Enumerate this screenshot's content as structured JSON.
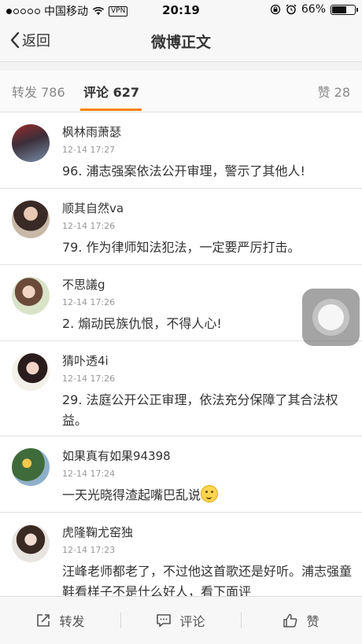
{
  "status_bar": {
    "carrier": "中国移动",
    "vpn": "VPN",
    "time": "20:19",
    "battery": "66%",
    "battery_level": 0.66
  },
  "nav": {
    "back_label": "返回",
    "title": "微博正文"
  },
  "tabs": {
    "repost": "转发 786",
    "comment": "评论 627",
    "like": "赞 28"
  },
  "comments": [
    {
      "name": "枫林雨萧瑟",
      "time": "12-14 17:27",
      "text": "96. 浦志强案依法公开审理，警示了其他人!"
    },
    {
      "name": "顺其自然va",
      "time": "12-14 17:26",
      "text": "79. 作为律师知法犯法，一定要严厉打击。"
    },
    {
      "name": "不思議g",
      "time": "12-14 17:26",
      "text": "2. 煽动民族仇恨，不得人心!"
    },
    {
      "name": "猜卟透4i",
      "time": "12-14 17:26",
      "text": "29. 法庭公开公正审理，依法充分保障了其合法权益。"
    },
    {
      "name": "如果真有如果94398",
      "time": "12-14 17:24",
      "text": "一天光晓得渣起嘴巴乱说"
    },
    {
      "name": "虎隆鞠尤窑独",
      "time": "12-14 17:23",
      "text": "汪峰老师都老了，不过他这首歌还是好听。浦志强童鞋看样子不是什么好人，看下面评"
    }
  ],
  "toolbar": {
    "repost": "转发",
    "comment": "评论",
    "like": "赞"
  },
  "colors": {
    "accent": "#ff8200"
  },
  "icons": [
    "back-chevron-icon",
    "wifi-icon",
    "lock-rotation-icon",
    "alarm-icon",
    "battery-icon",
    "share-icon",
    "comment-icon",
    "thumbs-up-icon",
    "thinking-emoji-icon"
  ]
}
